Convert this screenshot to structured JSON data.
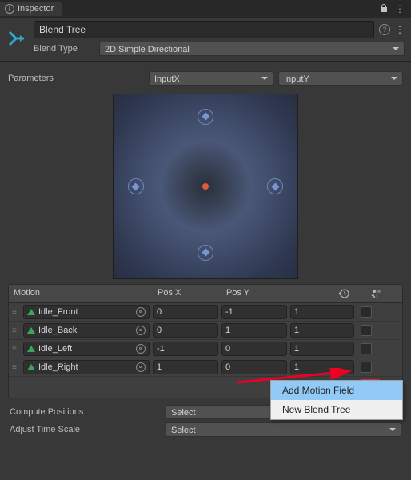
{
  "tab": {
    "title": "Inspector"
  },
  "header": {
    "name": "Blend Tree",
    "blend_type_label": "Blend Type",
    "blend_type_value": "2D Simple Directional"
  },
  "parameters": {
    "label": "Parameters",
    "x": "InputX",
    "y": "InputY"
  },
  "motion_table": {
    "head": {
      "motion": "Motion",
      "posx": "Pos X",
      "posy": "Pos Y"
    },
    "rows": [
      {
        "name": "Idle_Front",
        "posx": "0",
        "posy": "-1",
        "speed": "1"
      },
      {
        "name": "Idle_Back",
        "posx": "0",
        "posy": "1",
        "speed": "1"
      },
      {
        "name": "Idle_Left",
        "posx": "-1",
        "posy": "0",
        "speed": "1"
      },
      {
        "name": "Idle_Right",
        "posx": "1",
        "posy": "0",
        "speed": "1"
      }
    ]
  },
  "compute": {
    "positions_label": "Compute Positions",
    "positions_value": "Select",
    "timescale_label": "Adjust Time Scale",
    "timescale_value": "Select"
  },
  "context_menu": {
    "items": [
      {
        "label": "Add Motion Field",
        "selected": true
      },
      {
        "label": "New Blend Tree",
        "selected": false
      }
    ]
  },
  "icons": {
    "lock": "lock-icon",
    "kebab": "kebab-icon",
    "help": "help-icon",
    "clock": "clock-icon",
    "mirror": "mirror-icon"
  }
}
